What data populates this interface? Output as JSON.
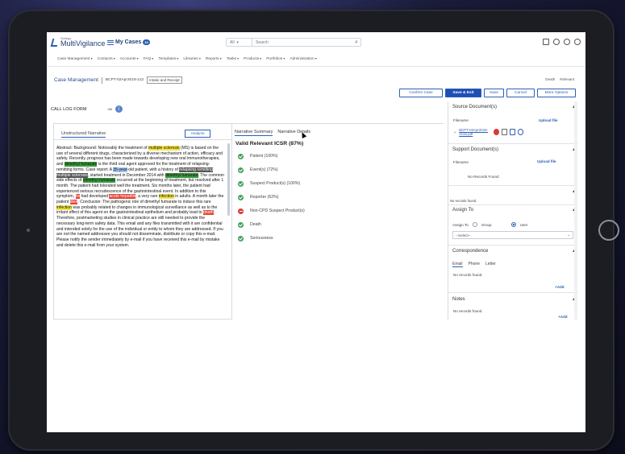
{
  "header": {
    "logo_small": "Sollego",
    "logo_big": "MultiVigilance",
    "my_cases_label": "My Cases",
    "my_cases_count": "16",
    "search_scope": "All",
    "search_placeholder": "Search"
  },
  "menu": [
    "Case Management",
    "Contacts",
    "Accounts",
    "FAQ",
    "Templates",
    "Libraries",
    "Reports",
    "Tasks",
    "Products",
    "Portfolios",
    "Administration"
  ],
  "breadcrumb": {
    "title": "Case Management",
    "case_id": "BCPT-02Apr2019-212",
    "status": "Intake and Receipt"
  },
  "top_links": [
    "Death",
    "Relevant"
  ],
  "actions": {
    "confirm": "Confirm Case",
    "save_exit": "Save & Exit",
    "save": "Save",
    "cancel": "Cancel",
    "more": "More Options"
  },
  "call_log": {
    "title": "CALL LOG FORM",
    "sub": "ow"
  },
  "left": {
    "tab": "Unstructured Narrative",
    "analyze": "Analyze",
    "narrative": {
      "t1": "Abstract: Background: Noticeably the treatment of ",
      "h1": "multiple sclerosis",
      "t2": " (MS) is based on the use of several different drugs, characterized by a diverse mechanism of action, efficacy and safety. Recently, progress has been made towards developing new oral immunotherapies, and ",
      "h2": "dimethyl fumarate",
      "t3": " is the third oral agent approved for the treatment of relapsing-remitting forms. Case report: A ",
      "h3": "35-year",
      "t4": "-old patient, with a history of ",
      "h4": "relapsing remitting multiple sclerosis",
      "t5": ", started treatment in December 2014 with ",
      "h5": "dimethyl fumarate",
      "t6": ". The common side effects of ",
      "h6": "dimethyl fumarate",
      "t7": " occurred at the beginning of treatment, but resolved after 1 month. The patient had tolerated well the treatment. Six months later, the patient had experienced serious recrudescence of the gastrointestinal event. In addition to this symptom, ",
      "h7": "he",
      "t8": " had developed ",
      "h8": "acute hepatitis",
      "t9": ", a very rare ",
      "h9": "infection",
      "t10": " in adults. A month later the patient ",
      "h10": "died",
      "t11": ". Conclusion: The pathogenic role of dimethyl fumarate to induce this rare ",
      "h11": "infection",
      "t12": " was probably related to changes in immunological surveillance as well as to the irritant effect of this agent on the gastrointestinal epithelium and probably lead to ",
      "h12": "death",
      "t13": ". Therefore, postmarketing studies in clinical practice are still needed to provide the necessary long-term safety data. This email and any files transmitted with it are confidential and intended solely for the use of the individual or entity to whom they are addressed. If you are not the named addressee you should not disseminate, distribute or copy this e-mail. Please notify the sender immediately by e-mail if you have received this e-mail by mistake and delete this e-mail from your system."
    }
  },
  "middle": {
    "tab_summary": "Narrative Summary",
    "tab_details": "Narrative Details",
    "icsr_title": "Valid Relevant ICSR (87%)",
    "checks": [
      {
        "label": "Patient  (100%)",
        "ok": true
      },
      {
        "label": "Event(s)  (72%)",
        "ok": true
      },
      {
        "label": "Suspect Product(s)  (100%)",
        "ok": true
      },
      {
        "label": "Reporter  (62%)",
        "ok": true
      },
      {
        "label": "Non-CPD Suspect Product(s)",
        "ok": false
      },
      {
        "label": "Death",
        "ok": true
      },
      {
        "label": "Seriousness",
        "ok": true
      }
    ]
  },
  "right": {
    "source_title": "Source Document(s)",
    "filename_label": "Filename",
    "upload_label": "Upload file",
    "file_name": "BCPT-02Apr2019-212a.pdf",
    "support_title": "Support Document(s)",
    "no_records_found": "No Records Found",
    "no_records_short": "No records found.",
    "assign_title": "Assign To",
    "assign_label": "Assign To",
    "group": "Group",
    "user": "User",
    "select_placeholder": "--Select--",
    "corr_title": "Correspondence",
    "email": "Email",
    "phone": "Phone",
    "letter": "Letter",
    "add": "Add",
    "notes_title": "Notes"
  }
}
